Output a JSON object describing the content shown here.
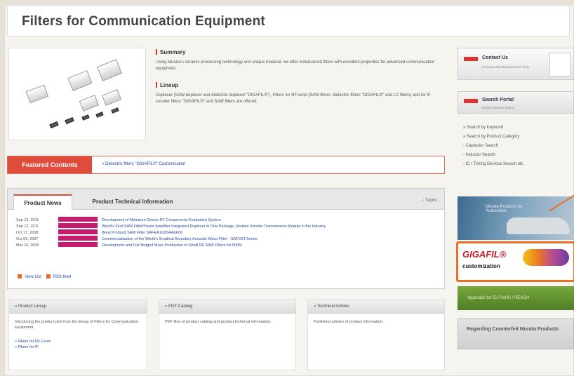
{
  "page": {
    "title": "Filters for Communication Equipment"
  },
  "summary": {
    "heading": "Summary",
    "text": "Using Murata's ceramic processing technology and unique material, we offer miniaturized filters with excellent properties for advanced communication equipment.",
    "lineup_heading": "Lineup",
    "lineup_text": "Duplexer (SAW duplexer and dielectric duplexer \"DIGAFIL®\"), Filters for RF-level (SAW filters, dielectric filters \"DIGAFIL®\" and LC filters) and for IF counter filters \"GIGAFIL®\" and SAW filters are offered."
  },
  "featured": {
    "label": "Featured Contents",
    "link": "» Dielectric filters \"GIGAFIL®\" Customization"
  },
  "news": {
    "tabs": [
      "Product News",
      "Product Technical Information"
    ],
    "topics": "Topics",
    "rows": [
      {
        "date": "Sep 12, 2011",
        "title": "Development of Miniature Device RF Components Evaluation System"
      },
      {
        "date": "Sep 12, 2011",
        "title": "World's First SAW Filter/Power Amplifier Integrated Duplexer in One Package, Realize Smaller Transmission Module in the Industry"
      },
      {
        "date": "Oct 17, 2008",
        "title": "[New Product] SAW Filter SAFEA1G95AA0F00"
      },
      {
        "date": "Oct 09, 2007",
        "title": "Commercialization of the World's Smallest Boundary Acoustic Wave Filter - SAFC04 Series"
      },
      {
        "date": "Mar 16, 2006",
        "title": "Development and Full-fledged Mass Production of Small RF SAW Filters for 800M"
      }
    ],
    "footer_list": "View List",
    "footer_rss": "RSS feed"
  },
  "boxes": [
    {
      "title": "» Product Lineup",
      "text": "Introducing the product pick from the lineup of Filters for Communication Equipment.",
      "links": [
        "» Filters for RF-Level",
        "» Filters for IF"
      ]
    },
    {
      "title": "» PDF Catalog",
      "text": "PDF files of product catalog and product technical information.",
      "links": []
    },
    {
      "title": "» Technical Articles",
      "text": "Published articles of product information.",
      "links": []
    }
  ],
  "sidebar": {
    "contact": {
      "title": "Contact Us",
      "sub": "Products and Measurement Tools"
    },
    "portal": {
      "title": "Search Portal",
      "sub": "Explore product search",
      "items": [
        "» Search by Keyword",
        "» Search by Product Category",
        "  - Capacitor Search",
        "  - Inductor Search",
        "  - IC / Timing Devices Search  etc"
      ]
    },
    "car_caption": "Murata Products for Automotive",
    "gigafil": {
      "title": "GIGAFIL®",
      "sub": "customization"
    },
    "reach": "Approach for EU RoHS / REACH",
    "counterfeit": "Regarding Counterfeit Murata Products"
  }
}
